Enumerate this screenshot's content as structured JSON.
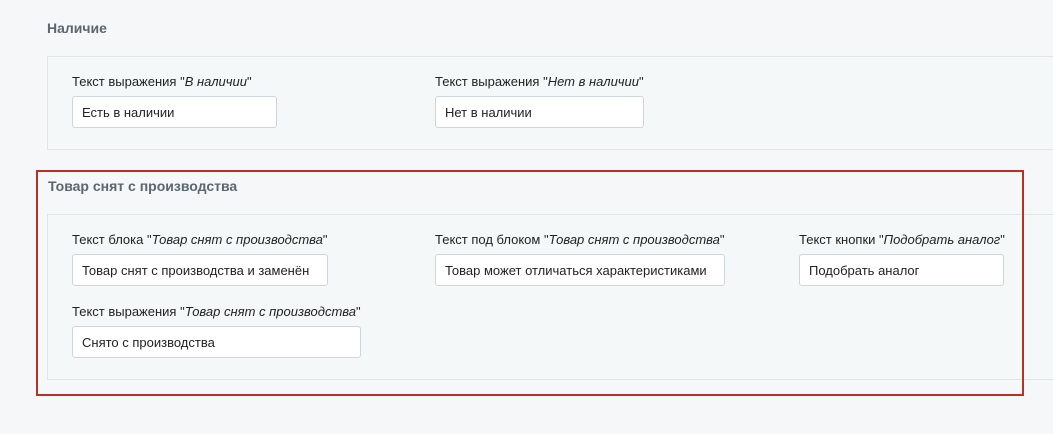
{
  "availability": {
    "title": "Наличие",
    "in_stock": {
      "label_prefix": "Текст выражения \"",
      "label_em": "В наличии",
      "label_suffix": "\"",
      "value": "Есть в наличии"
    },
    "out_of_stock": {
      "label_prefix": "Текст выражения \"",
      "label_em": "Нет в наличии",
      "label_suffix": "\"",
      "value": "Нет в наличии"
    }
  },
  "discontinued": {
    "title": "Товар снят с производства",
    "block_text": {
      "label_prefix": "Текст блока \"",
      "label_em": "Товар снят с производства",
      "label_suffix": "\"",
      "value": "Товар снят с производства и заменён"
    },
    "under_block_text": {
      "label_prefix": "Текст под блоком \"",
      "label_em": "Товар снят с производства",
      "label_suffix": "\"",
      "value": "Товар может отличаться характеристиками"
    },
    "button_text": {
      "label_prefix": "Текст кнопки \"",
      "label_em": "Подобрать аналог",
      "label_suffix": "\"",
      "value": "Подобрать аналог"
    },
    "expression_text": {
      "label_prefix": "Текст выражения \"",
      "label_em": "Товар снят с производства",
      "label_suffix": "\"",
      "value": "Снято с производства"
    }
  },
  "colors": {
    "highlight": "#b83224",
    "section_title": "#5a6670"
  }
}
